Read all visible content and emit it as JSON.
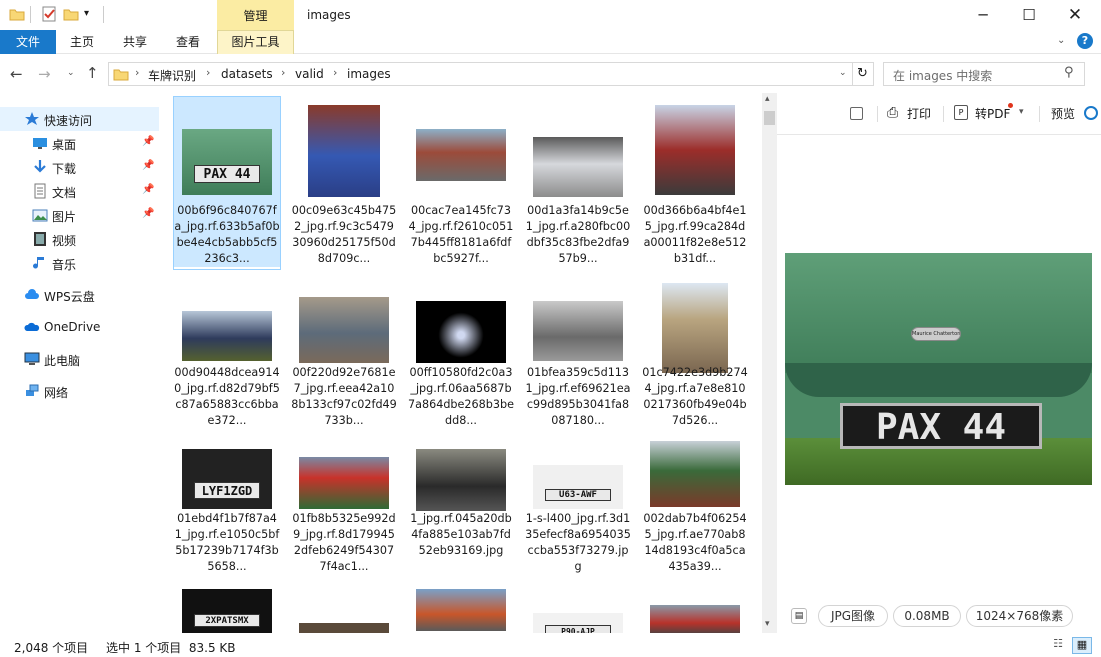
{
  "title_bar": {
    "context_tab": "管理",
    "window_title": "images"
  },
  "ribbon": {
    "tabs": [
      "文件",
      "主页",
      "共享",
      "查看",
      "图片工具"
    ]
  },
  "address": {
    "crumbs": [
      "车牌识别",
      "datasets",
      "valid",
      "images"
    ],
    "search_placeholder": "在 images 中搜索"
  },
  "nav": {
    "items": [
      {
        "label": "快速访问",
        "icon": "star-icon",
        "pinned": false
      },
      {
        "label": "桌面",
        "icon": "desktop-icon",
        "pinned": true
      },
      {
        "label": "下载",
        "icon": "download-icon",
        "pinned": true
      },
      {
        "label": "文档",
        "icon": "document-icon",
        "pinned": true
      },
      {
        "label": "图片",
        "icon": "pictures-icon",
        "pinned": true
      },
      {
        "label": "视频",
        "icon": "video-icon",
        "pinned": false
      },
      {
        "label": "音乐",
        "icon": "music-icon",
        "pinned": false
      },
      {
        "label": "WPS云盘",
        "icon": "cloud-icon",
        "pinned": false
      },
      {
        "label": "OneDrive",
        "icon": "onedrive-icon",
        "pinned": false
      },
      {
        "label": "此电脑",
        "icon": "computer-icon",
        "pinned": false
      },
      {
        "label": "网络",
        "icon": "network-icon",
        "pinned": false
      }
    ]
  },
  "files": [
    {
      "name": "00b6f96c840767fa_jpg.rf.633b5af0bbe4e4cb5abb5cf5236c3...",
      "plate": "PAX 44",
      "selected": true
    },
    {
      "name": "00c09e63c45b4752_jpg.rf.9c3c547930960d25175f50d8d709c..."
    },
    {
      "name": "00cac7ea145fc734_jpg.rf.f2610c0517b445ff8181a6fdfbc5927f..."
    },
    {
      "name": "00d1a3fa14b9c5e1_jpg.rf.a280fbc00dbf35c83fbe2dfa957b9..."
    },
    {
      "name": "00d366b6a4bf4e15_jpg.rf.99ca284da00011f82e8e512b31df..."
    },
    {
      "name": "00d90448dcea9140_jpg.rf.d82d79bf5c87a65883cc6bbae372..."
    },
    {
      "name": "00f220d92e7681e7_jpg.rf.eea42a108b133cf97c02fd49733b..."
    },
    {
      "name": "00ff10580fd2c0a3_jpg.rf.06aa5687b7a864dbe268b3bedd8..."
    },
    {
      "name": "01bfea359c5d1131_jpg.rf.ef69621eac99d895b3041fa8087180..."
    },
    {
      "name": "01c7422e3d9b2744_jpg.rf.a7e8e8100217360fb49e04b7d526..."
    },
    {
      "name": "01ebd4f1b7f87a41_jpg.rf.e1050c5bf5b17239b7174f3b5658...",
      "plate": "LYF1ZGD"
    },
    {
      "name": "01fb8b5325e992d9_jpg.rf.8d1799452dfeb6249f543077f4ac1..."
    },
    {
      "name": "1_jpg.rf.045a20db4fa885e103ab7fd52eb93169.jpg"
    },
    {
      "name": "1-s-l400_jpg.rf.3d135efecf8a6954035ccba553f73279.jpg",
      "plate": "U63-AWF"
    },
    {
      "name": "002dab7b4f062545_jpg.rf.ae770ab814d8193c4f0a5ca435a39..."
    },
    {
      "name": "",
      "plate": "2XPATSMX"
    },
    {
      "name": ""
    },
    {
      "name": ""
    },
    {
      "name": "",
      "plate": "P90-AJP"
    },
    {
      "name": ""
    }
  ],
  "preview": {
    "print_label": "打印",
    "pdf_label": "转PDF",
    "preview_label": "预览",
    "plate_text": "PAX 44",
    "badge_text": "Maurice Chatterton",
    "file_type": "JPG图像",
    "file_size": "0.08MB",
    "dimensions": "1024×768像素"
  },
  "status": {
    "item_count": "2,048 个项目",
    "selection": "选中 1 个项目  83.5 KB"
  },
  "colors": {
    "accent": "#1979ca",
    "selection": "#cce8ff",
    "context_tab": "#fbeca3"
  }
}
